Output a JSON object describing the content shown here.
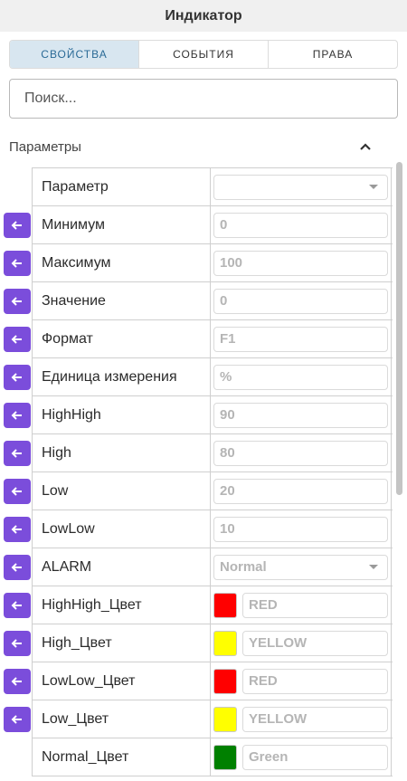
{
  "header": {
    "title": "Индикатор"
  },
  "tabs": [
    {
      "label": "СВОЙСТВА",
      "active": true
    },
    {
      "label": "СОБЫТИЯ",
      "active": false
    },
    {
      "label": "ПРАВА",
      "active": false
    }
  ],
  "search": {
    "placeholder": "Поиск..."
  },
  "section": {
    "title": "Параметры",
    "icon": "chevron-up-icon"
  },
  "link_icon": "arrow-left-icon",
  "colors": {
    "accent": "#7b4ddb",
    "tab_active_bg": "#d8e6f0",
    "tab_active_text": "#2a6a96"
  },
  "rows": [
    {
      "label": "Параметр",
      "value": "",
      "kind": "select",
      "link": false
    },
    {
      "label": "Минимум",
      "value": "0",
      "kind": "text",
      "link": true
    },
    {
      "label": "Максимум",
      "value": "100",
      "kind": "text",
      "link": true
    },
    {
      "label": "Значение",
      "value": "0",
      "kind": "text",
      "link": true
    },
    {
      "label": "Формат",
      "value": "F1",
      "kind": "text",
      "link": true
    },
    {
      "label": "Единица измерения",
      "value": "%",
      "kind": "text",
      "link": true
    },
    {
      "label": "HighHigh",
      "value": "90",
      "kind": "text",
      "link": true
    },
    {
      "label": "High",
      "value": "80",
      "kind": "text",
      "link": true
    },
    {
      "label": "Low",
      "value": "20",
      "kind": "text",
      "link": true
    },
    {
      "label": "LowLow",
      "value": "10",
      "kind": "text",
      "link": true
    },
    {
      "label": "ALARM",
      "value": "Normal",
      "kind": "select",
      "link": true
    },
    {
      "label": "HighHigh_Цвет",
      "value": "RED",
      "kind": "color",
      "color": "#ff0000",
      "link": true
    },
    {
      "label": "High_Цвет",
      "value": "YELLOW",
      "kind": "color",
      "color": "#ffff00",
      "link": true
    },
    {
      "label": "LowLow_Цвет",
      "value": "RED",
      "kind": "color",
      "color": "#ff0000",
      "link": true
    },
    {
      "label": "Low_Цвет",
      "value": "YELLOW",
      "kind": "color",
      "color": "#ffff00",
      "link": true
    },
    {
      "label": "Normal_Цвет",
      "value": "Green",
      "kind": "color",
      "color": "#008000",
      "link": false
    }
  ]
}
